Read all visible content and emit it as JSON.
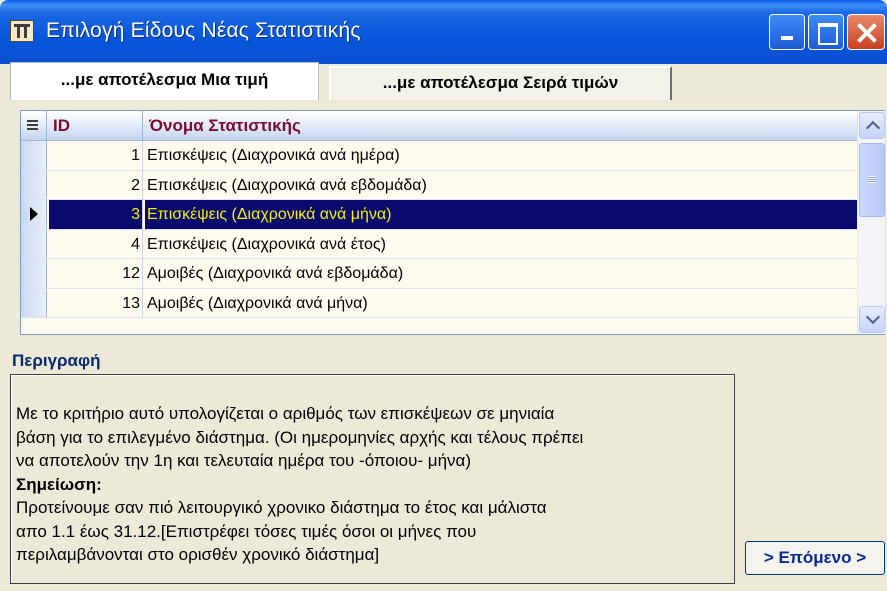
{
  "window": {
    "title": "Επιλογή Είδους Νέας Στατιστικής"
  },
  "tabs": [
    {
      "label": "...με αποτέλεσμα Μια τιμή",
      "active": true
    },
    {
      "label": "...με αποτέλεσμα Σειρά τιμών",
      "active": false
    }
  ],
  "grid": {
    "columns": [
      "ID",
      "Όνομα Στατιστικής"
    ],
    "rows": [
      {
        "id": "1",
        "name": "Επισκέψεις (Διαχρονικά ανά ημέρα)"
      },
      {
        "id": "2",
        "name": "Επισκέψεις (Διαχρονικά ανά εβδομάδα)"
      },
      {
        "id": "3",
        "name": "Επισκέψεις (Διαχρονικά ανά μήνα)"
      },
      {
        "id": "4",
        "name": "Επισκέψεις (Διαχρονικά ανά έτος)"
      },
      {
        "id": "12",
        "name": "Αμοιβές (Διαχρονικά ανά εβδομάδα)"
      },
      {
        "id": "13",
        "name": "Αμοιβές (Διαχρονικά ανά μήνα)"
      }
    ],
    "selected_id": "3"
  },
  "description": {
    "label": "Περιγραφή",
    "lines": [
      "Με το κριτήριο αυτό υπολογίζεται ο αριθμός των επισκέψεων σε μηνιαία",
      "βάση για το επιλεγμένο διάστημα. (Οι ημερομηνίες αρχής και τέλους πρέπει",
      "να αποτελούν την 1η και τελευταία ημέρα του -όποιου-  μήνα)",
      "Σημείωση:",
      "Προτείνουμε σαν πιό λειτουργικό χρονικο διάστημα το έτος και μάλιστα",
      "απο 1.1 έως 31.12.[Επιστρέφει τόσες τιμές όσοι οι μήνες που",
      "περιλαμβάνονται στο ορισθέν χρονικό διάστημα]"
    ]
  },
  "buttons": {
    "next": "> Επόμενο >"
  },
  "colors": {
    "titlebar": "#0656DA",
    "selection_bg": "#0A0A6E",
    "selection_text": "#F2F200",
    "header_text": "#7A0D2E"
  }
}
